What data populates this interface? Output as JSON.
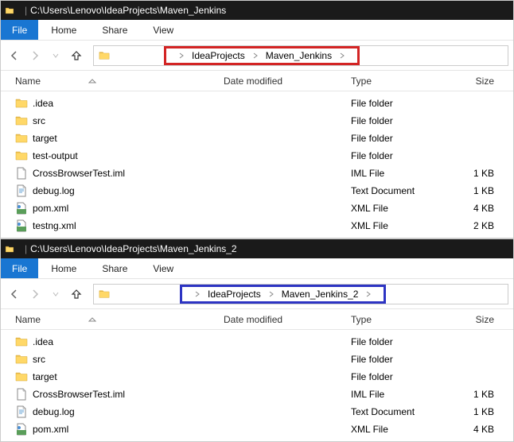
{
  "windows": [
    {
      "title_path": "C:\\Users\\Lenovo\\IdeaProjects\\Maven_Jenkins",
      "menu": {
        "file": "File",
        "home": "Home",
        "share": "Share",
        "view": "View"
      },
      "breadcrumb_highlight": "red",
      "breadcrumbs": [
        "IdeaProjects",
        "Maven_Jenkins"
      ],
      "columns": {
        "name": "Name",
        "date": "Date modified",
        "type": "Type",
        "size": "Size"
      },
      "items": [
        {
          "icon": "folder",
          "name": ".idea",
          "date": "",
          "type": "File folder",
          "size": ""
        },
        {
          "icon": "folder",
          "name": "src",
          "date": "",
          "type": "File folder",
          "size": ""
        },
        {
          "icon": "folder",
          "name": "target",
          "date": "",
          "type": "File folder",
          "size": ""
        },
        {
          "icon": "folder",
          "name": "test-output",
          "date": "",
          "type": "File folder",
          "size": ""
        },
        {
          "icon": "file",
          "name": "CrossBrowserTest.iml",
          "date": "",
          "type": "IML File",
          "size": "1 KB"
        },
        {
          "icon": "text",
          "name": "debug.log",
          "date": "",
          "type": "Text Document",
          "size": "1 KB"
        },
        {
          "icon": "xml",
          "name": "pom.xml",
          "date": "",
          "type": "XML File",
          "size": "4 KB"
        },
        {
          "icon": "xml",
          "name": "testng.xml",
          "date": "",
          "type": "XML File",
          "size": "2 KB"
        }
      ]
    },
    {
      "title_path": "C:\\Users\\Lenovo\\IdeaProjects\\Maven_Jenkins_2",
      "menu": {
        "file": "File",
        "home": "Home",
        "share": "Share",
        "view": "View"
      },
      "breadcrumb_highlight": "blue",
      "breadcrumbs": [
        "IdeaProjects",
        "Maven_Jenkins_2"
      ],
      "columns": {
        "name": "Name",
        "date": "Date modified",
        "type": "Type",
        "size": "Size"
      },
      "items": [
        {
          "icon": "folder",
          "name": ".idea",
          "date": "",
          "type": "File folder",
          "size": ""
        },
        {
          "icon": "folder",
          "name": "src",
          "date": "",
          "type": "File folder",
          "size": ""
        },
        {
          "icon": "folder",
          "name": "target",
          "date": "",
          "type": "File folder",
          "size": ""
        },
        {
          "icon": "file",
          "name": "CrossBrowserTest.iml",
          "date": "",
          "type": "IML File",
          "size": "1 KB"
        },
        {
          "icon": "text",
          "name": "debug.log",
          "date": "",
          "type": "Text Document",
          "size": "1 KB"
        },
        {
          "icon": "xml",
          "name": "pom.xml",
          "date": "",
          "type": "XML File",
          "size": "4 KB"
        }
      ]
    }
  ]
}
